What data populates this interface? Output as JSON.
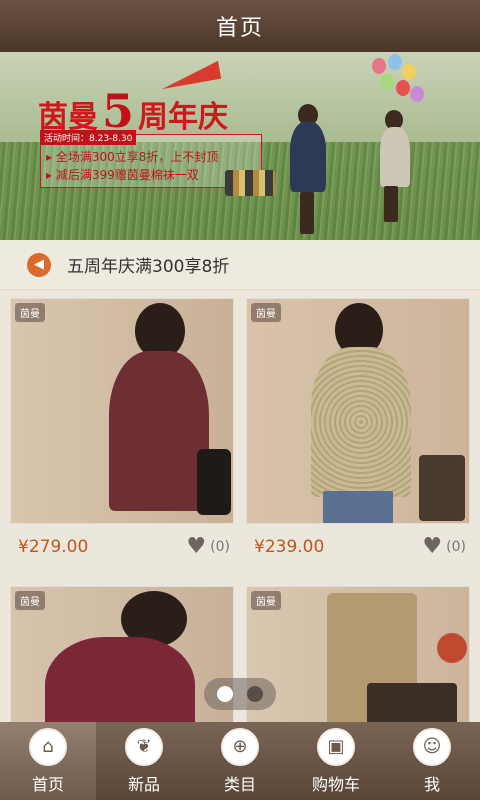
{
  "header": {
    "title": "首页"
  },
  "banner": {
    "brand_prefix": "茵曼",
    "big_number": "5",
    "title_suffix": "周年庆",
    "date": "活动时间：8.23-8.30",
    "line1": "▸ 全场满300立享8折，上不封顶",
    "line2": "▸ 减后满399赠茵曼棉袜一双",
    "active_slide": 1,
    "slide_count": 4
  },
  "notice": {
    "text": "五周年庆满300享8折",
    "icon": "speaker-icon"
  },
  "products": [
    {
      "price": "¥279.00",
      "likes": "(0)",
      "brand": "茵曼"
    },
    {
      "price": "¥239.00",
      "likes": "(0)",
      "brand": "茵曼"
    },
    {
      "brand": "茵曼"
    },
    {
      "brand": "茵曼"
    }
  ],
  "pager": {
    "active": 1,
    "count": 2
  },
  "tabs": [
    {
      "label": "首页",
      "icon": "home-icon",
      "active": true
    },
    {
      "label": "新品",
      "icon": "leaf-icon",
      "active": false
    },
    {
      "label": "类目",
      "icon": "category-icon",
      "active": false
    },
    {
      "label": "购物车",
      "icon": "shopping-bag-icon",
      "active": false
    },
    {
      "label": "我",
      "icon": "user-icon",
      "active": false
    }
  ],
  "colors": {
    "header": "#5a4638",
    "price": "#c0561a",
    "accent_red": "#c11219"
  }
}
